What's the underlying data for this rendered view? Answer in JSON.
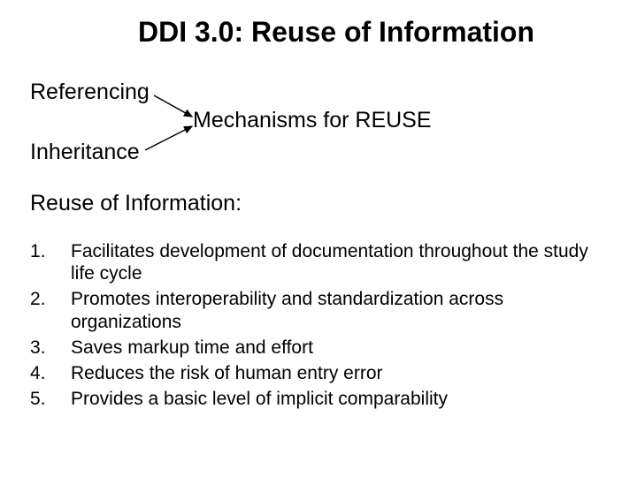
{
  "title": "DDI 3.0: Reuse of Information",
  "mechanisms": {
    "top_label": "Referencing",
    "bottom_label": "Inheritance",
    "target_label": "Mechanisms for REUSE"
  },
  "subheading": "Reuse of Information:",
  "list": [
    {
      "num": "1.",
      "text": "Facilitates development of documentation throughout the study life cycle"
    },
    {
      "num": "2.",
      "text": "Promotes interoperability and standardization across organizations"
    },
    {
      "num": "3.",
      "text": "Saves markup time and effort"
    },
    {
      "num": "4.",
      "text": "Reduces the risk of human entry error"
    },
    {
      "num": "5.",
      "text": "Provides a basic level of implicit comparability"
    }
  ]
}
